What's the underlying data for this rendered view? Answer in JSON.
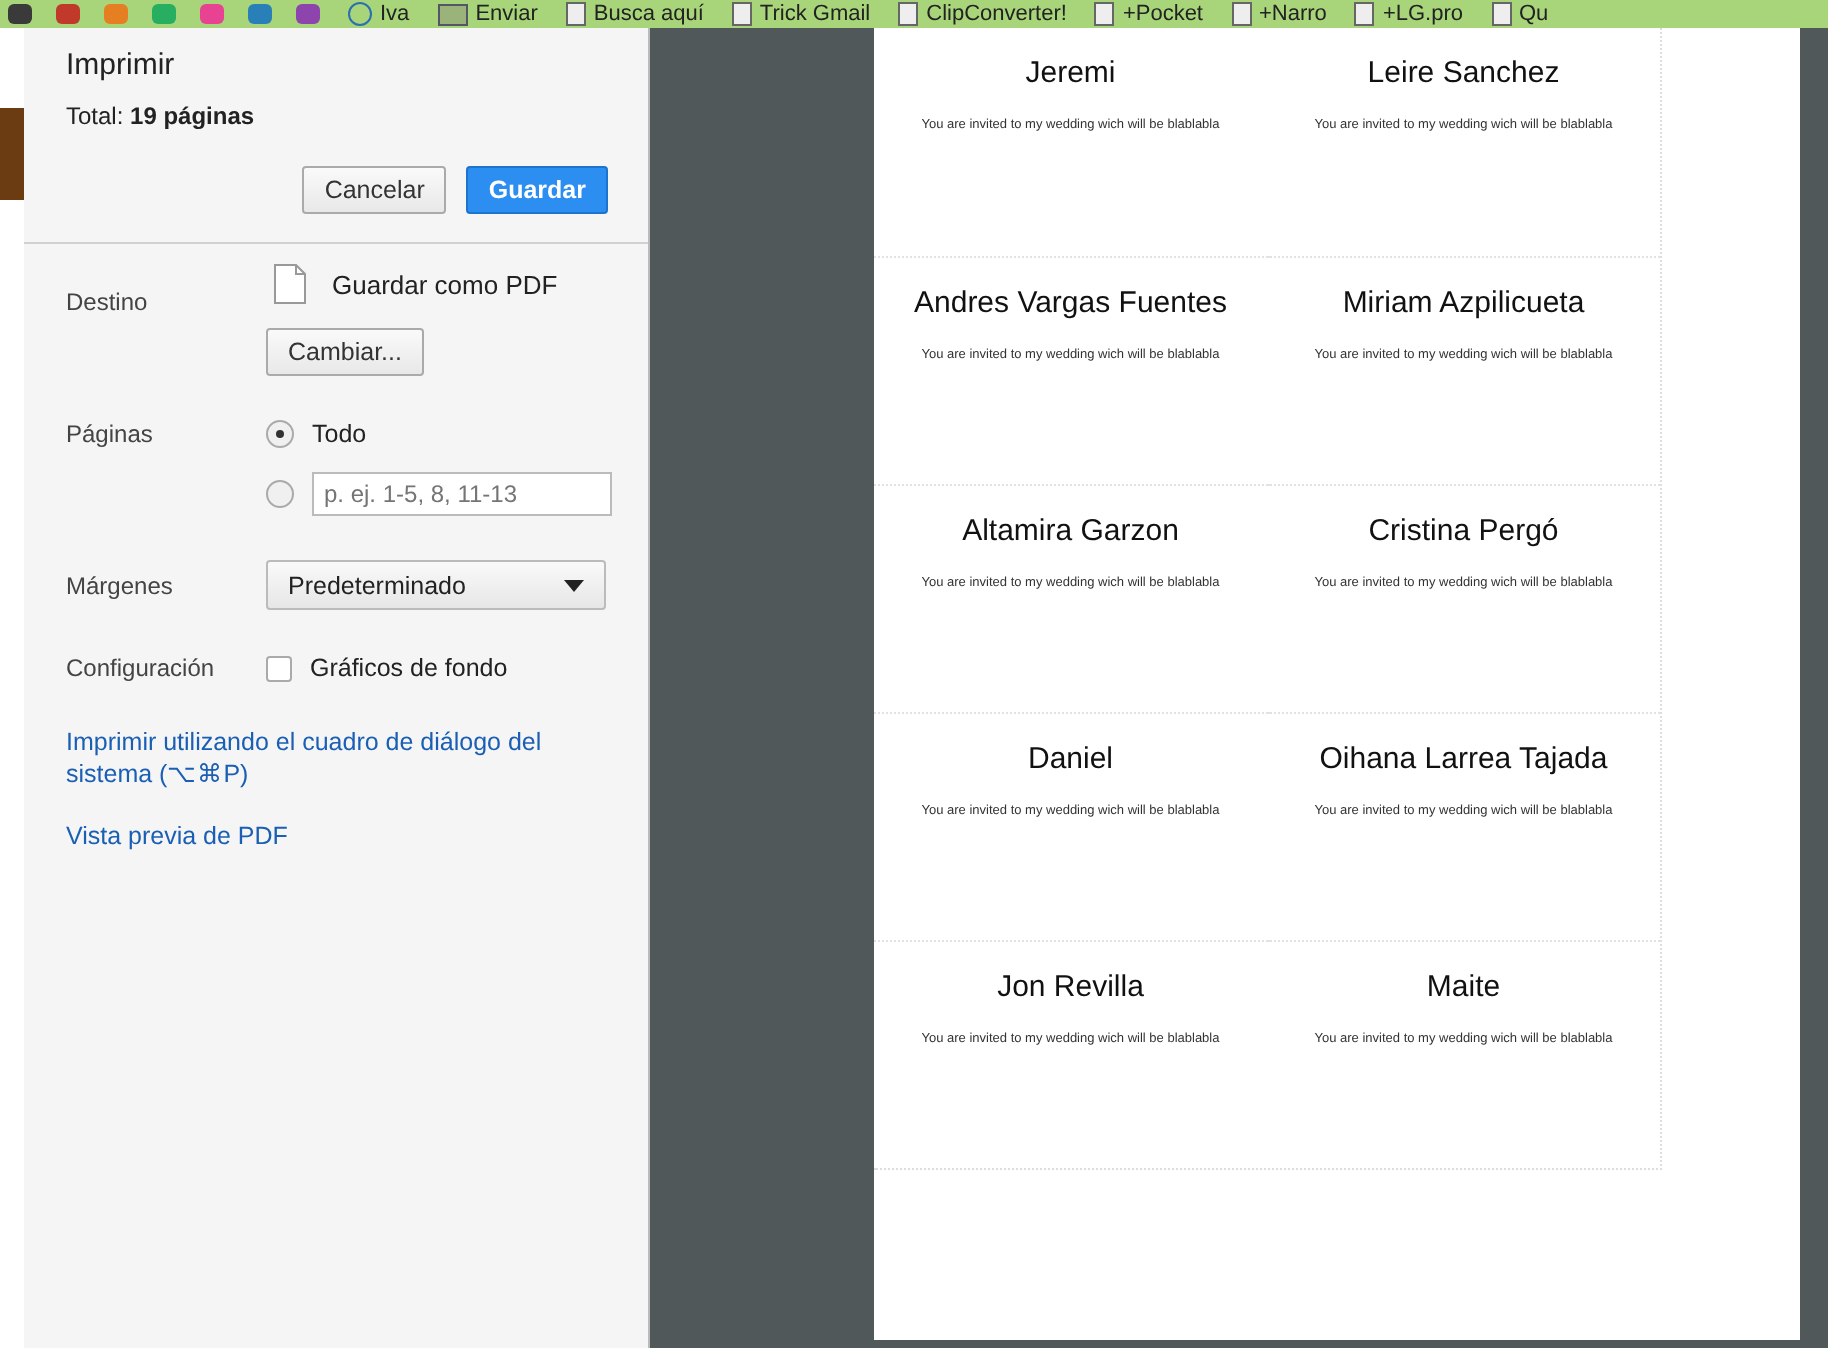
{
  "bookmarks_bar": {
    "items": [
      {
        "label": "Iva",
        "kind": "circle"
      },
      {
        "label": "Enviar",
        "kind": "folder"
      },
      {
        "label": "Busca aquí",
        "kind": "page"
      },
      {
        "label": "Trick Gmail",
        "kind": "page"
      },
      {
        "label": "ClipConverter!",
        "kind": "page"
      },
      {
        "label": "+Pocket",
        "kind": "page"
      },
      {
        "label": "+Narro",
        "kind": "page"
      },
      {
        "label": "+LG.pro",
        "kind": "page"
      },
      {
        "label": "Qu",
        "kind": "page"
      }
    ]
  },
  "print_panel": {
    "title": "Imprimir",
    "total_label": "Total:",
    "total_value": "19 páginas",
    "buttons": [
      {
        "label": "Cancelar",
        "kind": "secondary"
      },
      {
        "label": "Guardar",
        "kind": "primary"
      }
    ],
    "destination": {
      "label": "Destino",
      "printer": "Guardar como PDF",
      "change_button": "Cambiar..."
    },
    "pages": {
      "label": "Páginas",
      "options": [
        {
          "kind": "all",
          "label": "Todo",
          "selected": true
        },
        {
          "kind": "range",
          "placeholder": "p. ej. 1-5, 8, 11-13",
          "selected": false
        }
      ]
    },
    "margins": {
      "label": "Márgenes",
      "value": "Predeterminado"
    },
    "settings": {
      "label": "Configuración",
      "options": [
        {
          "label": "Gráficos de fondo",
          "checked": false
        }
      ]
    },
    "links": [
      "Imprimir utilizando el cuadro de diálogo del sistema (⌥⌘P)",
      "Vista previa de PDF"
    ]
  },
  "preview": {
    "cards": [
      {
        "name": "Jeremi",
        "message": "You are invited to my wedding wich will be blablabla"
      },
      {
        "name": "Leire Sanchez",
        "message": "You are invited to my wedding wich will be blablabla"
      },
      {
        "name": "Andres Vargas Fuentes",
        "message": "You are invited to my wedding wich will be blablabla"
      },
      {
        "name": "Miriam Azpilicueta",
        "message": "You are invited to my wedding wich will be blablabla"
      },
      {
        "name": "Altamira Garzon",
        "message": "You are invited to my wedding wich will be blablabla"
      },
      {
        "name": "Cristina Pergó",
        "message": "You are invited to my wedding wich will be blablabla"
      },
      {
        "name": "Daniel",
        "message": "You are invited to my wedding wich will be blablabla"
      },
      {
        "name": "Oihana Larrea Tajada",
        "message": "You are invited to my wedding wich will be blablabla"
      },
      {
        "name": "Jon Revilla",
        "message": "You are invited to my wedding wich will be blablabla"
      },
      {
        "name": "Maite",
        "message": "You are invited to my wedding wich will be blablabla"
      }
    ]
  }
}
